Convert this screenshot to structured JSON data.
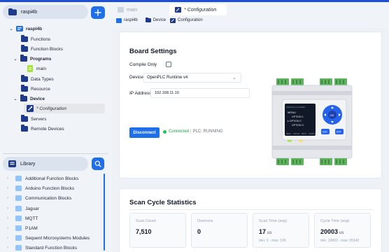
{
  "project": {
    "name": "raspi4b",
    "tree": [
      {
        "label": "raspi4b",
        "level": 0,
        "expanded": true,
        "icon": "plc-icon"
      },
      {
        "label": "Functions",
        "level": 1
      },
      {
        "label": "Function Blocks",
        "level": 1
      },
      {
        "label": "Programs",
        "level": 1,
        "expanded": true
      },
      {
        "label": "main",
        "level": 2
      },
      {
        "label": "Data Types",
        "level": 1
      },
      {
        "label": "Resource",
        "level": 1
      },
      {
        "label": "Device",
        "level": 1,
        "expanded": true
      },
      {
        "label": "* Configuration",
        "level": 2,
        "selected": true
      },
      {
        "label": "Servers",
        "level": 1
      },
      {
        "label": "Remote Devices",
        "level": 1
      }
    ]
  },
  "library": {
    "title": "Library",
    "items": [
      "Additional Function Blocks",
      "Arduino Function Blocks",
      "Communication Blocks",
      "Jaguar",
      "MQTT",
      "P1AM",
      "Sequent Microsystems Modules",
      "Standard Function Blocks"
    ]
  },
  "tabs": [
    {
      "label": "main",
      "active": false
    },
    {
      "label": "* Configuration",
      "active": true
    }
  ],
  "breadcrumb": [
    "raspi4b",
    "Device",
    "Configuration"
  ],
  "board": {
    "title": "Board Settings",
    "compile_only_label": "Compile Only",
    "device_label": "Device",
    "device_value": "OpenPLC Runtime v4",
    "ip_label": "IP Address",
    "ip_value": "192.168.11.10",
    "disconnect_label": "Disconnect",
    "connected_label": "Connected",
    "plc_status": "PLC: RUNNING"
  },
  "plc_screen": {
    "header": "Autonomy Controller",
    "menu_title": "MENU",
    "options": [
      "OPTION 1",
      "▸ OPTION 2",
      "OPTION 3"
    ],
    "bottom": [
      "MENU",
      "STATUS",
      "INPUT",
      "OUTPUT"
    ],
    "esc": "ESC",
    "ent": "ENT",
    "ok": "OK"
  },
  "scan": {
    "title": "Scan Cycle Statistics",
    "stats": [
      {
        "label": "Scan Count",
        "value": "7,510",
        "unit": "",
        "sub": ""
      },
      {
        "label": "Overruns",
        "value": "0",
        "unit": "",
        "sub": ""
      },
      {
        "label": "Scan Time (avg)",
        "value": "17",
        "unit": "us",
        "sub": "min: 0 · max: 109"
      },
      {
        "label": "Cycle Time (avg)",
        "value": "20003",
        "unit": "us",
        "sub": "min: 19903 · max: 20142"
      }
    ]
  },
  "colors": {
    "accent": "#1f6feb",
    "folder": "#1e3a8a",
    "connected": "#22c55e"
  }
}
